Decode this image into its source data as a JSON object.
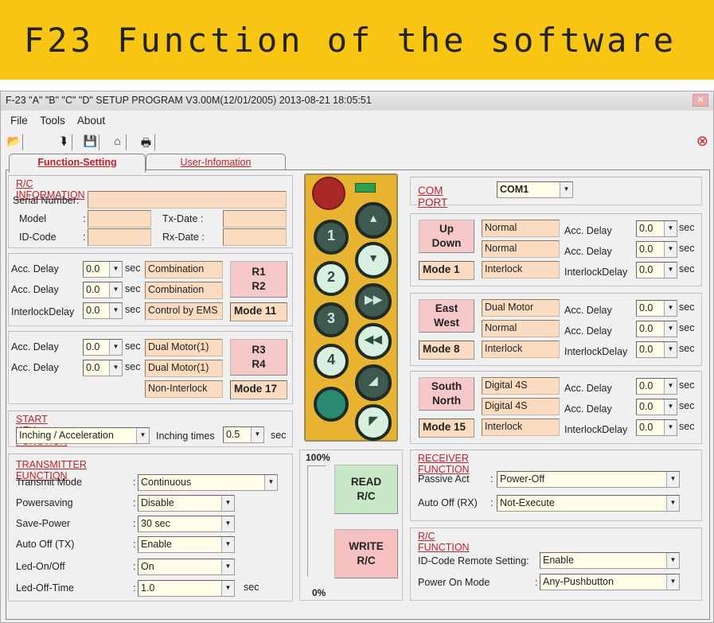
{
  "banner": {
    "title": "F23 Function of the software"
  },
  "window": {
    "title": "F-23 \"A\" \"B\" \"C\" \"D\" SETUP PROGRAM V3.00M(12/01/2005)  2013-08-21  18:05:51",
    "close": "✕"
  },
  "menu": [
    "File",
    "Tools",
    "About"
  ],
  "toolbar": [
    {
      "icon": "open-folder-icon",
      "glyph": "📂"
    },
    {
      "icon": "download-icon",
      "glyph": "⮯"
    },
    {
      "icon": "save-icon",
      "glyph": "💾"
    },
    {
      "icon": "home-icon",
      "glyph": "⌂"
    },
    {
      "icon": "print-icon",
      "glyph": "🖶"
    }
  ],
  "close_icon": "⊗",
  "tabs": [
    "Function-Setting",
    "User-Infomation"
  ],
  "rc_info": {
    "title": "R/C INFORMATION",
    "serial_label": "Serial Number:",
    "model_label": "Model",
    "idcode_label": "ID-Code",
    "colon": ":",
    "txdate_label": "Tx-Date :",
    "rxdate_label": "Rx-Date :",
    "serial": "",
    "model": "",
    "idcode": "",
    "txdate": "",
    "rxdate": ""
  },
  "left_groups": [
    {
      "rows": [
        {
          "label": "Acc. Delay",
          "value": "0.0",
          "unit": "sec",
          "func": "Combination"
        },
        {
          "label": "Acc. Delay",
          "value": "0.0",
          "unit": "sec",
          "func": "Combination"
        },
        {
          "label": "InterlockDelay",
          "value": "0.0",
          "unit": "sec",
          "func": "Control by EMS"
        }
      ],
      "button": [
        "R1",
        "R2"
      ],
      "mode": "Mode 11"
    },
    {
      "rows": [
        {
          "label": "Acc. Delay",
          "value": "0.0",
          "unit": "sec",
          "func": "Dual Motor(1)"
        },
        {
          "label": "Acc. Delay",
          "value": "0.0",
          "unit": "sec",
          "func": "Dual Motor(1)"
        },
        {
          "label": "",
          "value": "",
          "unit": "",
          "func": "Non-Interlock"
        }
      ],
      "button": [
        "R3",
        "R4"
      ],
      "mode": "Mode 17"
    }
  ],
  "start_key": {
    "title": "START KEY FUNCTION",
    "value": "Inching / Acceleration",
    "inching_label": "Inching times",
    "inching_value": "0.5",
    "unit": "sec"
  },
  "transmitter": {
    "title": "TRANSMITTER FUNCTION",
    "rows": [
      {
        "label": "Transmit Mode",
        "value": "Continuous",
        "unit": ""
      },
      {
        "label": "Powersaving",
        "value": "Disable",
        "unit": ""
      },
      {
        "label": "Save-Power",
        "value": "30 sec",
        "unit": ""
      },
      {
        "label": "Auto Off (TX)",
        "value": "Enable",
        "unit": ""
      },
      {
        "label": "Led-On/Off",
        "value": "On",
        "unit": ""
      },
      {
        "label": "Led-Off-Time",
        "value": "1.0",
        "unit": "sec"
      }
    ]
  },
  "remote": {
    "buttons_left": [
      "1",
      "2",
      "3",
      "4",
      ""
    ],
    "buttons_right": [
      "▲",
      "▼",
      "▶▶",
      "◀◀",
      "◢",
      "◤"
    ]
  },
  "progress": {
    "top": "100%",
    "bottom": "0%",
    "value": 0,
    "read": [
      "READ",
      "R/C"
    ],
    "write": [
      "WRITE",
      "R/C"
    ]
  },
  "com": {
    "label": "COM  PORT",
    "value": "COM1"
  },
  "right_groups": [
    {
      "button": [
        "Up",
        "Down"
      ],
      "mode": "Mode 1",
      "rows": [
        {
          "func": "Normal",
          "label": "Acc. Delay",
          "value": "0.0",
          "unit": "sec"
        },
        {
          "func": "Normal",
          "label": "Acc. Delay",
          "value": "0.0",
          "unit": "sec"
        },
        {
          "func": "Interlock",
          "label": "InterlockDelay",
          "value": "0.0",
          "unit": "sec"
        }
      ]
    },
    {
      "button": [
        "East",
        "West"
      ],
      "mode": "Mode 8",
      "rows": [
        {
          "func": "Dual Motor",
          "label": "Acc. Delay",
          "value": "0.0",
          "unit": "sec"
        },
        {
          "func": "Normal",
          "label": "Acc. Delay",
          "value": "0.0",
          "unit": "sec"
        },
        {
          "func": "Interlock",
          "label": "InterlockDelay",
          "value": "0.0",
          "unit": "sec"
        }
      ]
    },
    {
      "button": [
        "South",
        "North"
      ],
      "mode": "Mode 15",
      "rows": [
        {
          "func": "Digital 4S",
          "label": "Acc. Delay",
          "value": "0.0",
          "unit": "sec"
        },
        {
          "func": "Digital 4S",
          "label": "Acc. Delay",
          "value": "0.0",
          "unit": "sec"
        },
        {
          "func": "Interlock",
          "label": "InterlockDelay",
          "value": "0.0",
          "unit": "sec"
        }
      ]
    }
  ],
  "receiver": {
    "title": "RECEIVER  FUNCTION",
    "rows": [
      {
        "label": "Passive Act",
        "value": "Power-Off"
      },
      {
        "label": "Auto Off (RX)",
        "value": "Not-Execute"
      }
    ]
  },
  "rc_function": {
    "title": "R/C  FUNCTION",
    "rows": [
      {
        "label": "ID-Code Remote Setting:",
        "value": "Enable"
      },
      {
        "label": "Power On Mode",
        "value": "Any-Pushbutton"
      }
    ]
  },
  "colors": {
    "banner": "#f7c512",
    "field": "#fcdcc0",
    "mode_button": "#f7c8c8",
    "read_button": "#c8e8c8",
    "write_button": "#f7c0c0",
    "section_title": "#c0202a"
  }
}
